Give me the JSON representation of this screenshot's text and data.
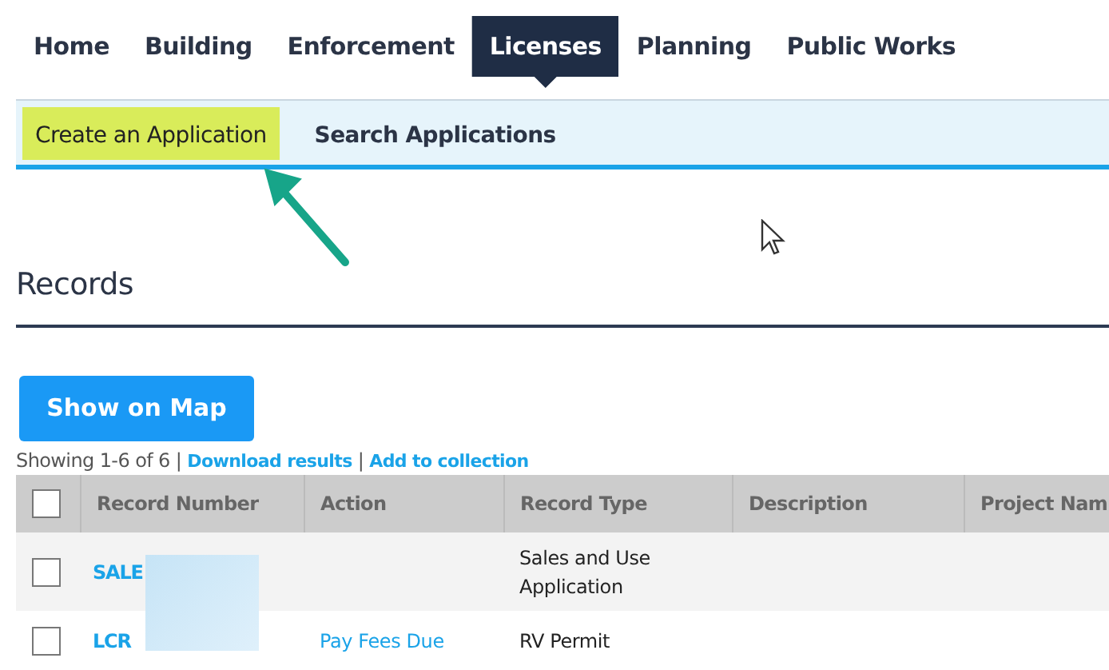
{
  "nav_tabs": [
    {
      "label": "Home",
      "selected": false
    },
    {
      "label": "Building",
      "selected": false
    },
    {
      "label": "Enforcement",
      "selected": false
    },
    {
      "label": "Licenses",
      "selected": true
    },
    {
      "label": "Planning",
      "selected": false
    },
    {
      "label": "Public Works",
      "selected": false
    }
  ],
  "sub_nav": [
    {
      "label": "Create an Application",
      "highlighted": true
    },
    {
      "label": "Search Applications",
      "highlighted": false
    }
  ],
  "section_title": "Records",
  "map_button": "Show on Map",
  "results": {
    "summary": "Showing 1-6 of 6",
    "separator_1": "|",
    "download_link": "Download results",
    "separator_2": "|",
    "collection_link": "Add to collection"
  },
  "table": {
    "select_all_checked": false,
    "columns": [
      "Record Number",
      "Action",
      "Record Type",
      "Description",
      "Project Nam"
    ],
    "rows": [
      {
        "checked": false,
        "record_number": "SALE",
        "action": "",
        "record_type": "Sales and Use Application"
      },
      {
        "checked": false,
        "record_number": "LCR",
        "action": "Pay Fees Due",
        "record_type": "RV Permit"
      }
    ]
  }
}
